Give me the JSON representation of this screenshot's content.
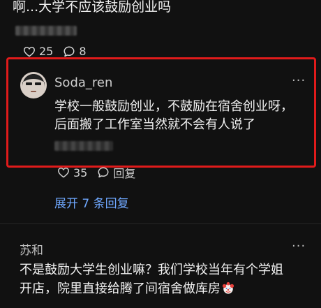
{
  "top_comment": {
    "text": "啊...大学不应该鼓励创业吗",
    "likes": "25",
    "replies": "8"
  },
  "reply": {
    "username": "Soda_ren",
    "more": "···",
    "lines": [
      "学校一般鼓励创业，不鼓励在宿舍创业呀，",
      "后面搬了工作室当然就不会有人说了"
    ],
    "likes": "35",
    "reply_label": "回复"
  },
  "expand": {
    "label": "展开 7 条回复"
  },
  "comment2": {
    "username": "苏和",
    "more": "···",
    "lines": [
      "不是鼓励大学生创业嘛？我们学校当年有个学姐",
      "开店，院里直接给腾了间宿舍做库房"
    ]
  },
  "colors": {
    "highlight": "#e01b1b",
    "link": "#6fa8ff",
    "background": "#111111"
  }
}
